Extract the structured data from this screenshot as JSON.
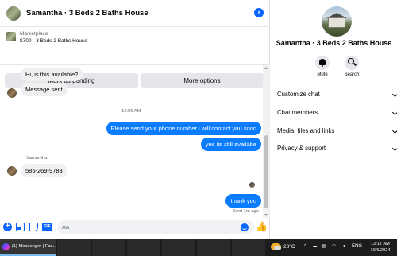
{
  "chat": {
    "title": "Samantha · 3 Beds 2 Baths House",
    "listing": {
      "source": "Marketplace",
      "description": "$700 · 3 Beds 2 Baths House"
    },
    "buttons": {
      "mark_pending": "Mark as pending",
      "more_options": "More options"
    },
    "messages": [
      {
        "direction": "incoming",
        "text": "Hi, is this available?"
      },
      {
        "direction": "incoming",
        "text": "Message sent"
      },
      {
        "type": "timestamp",
        "text": "12:06 AM"
      },
      {
        "direction": "outgoing",
        "text": "Please send your phone number i will contact you soon"
      },
      {
        "direction": "outgoing",
        "text": "yes its still availabe"
      },
      {
        "type": "sender",
        "text": "Samantha"
      },
      {
        "direction": "incoming",
        "text": "585-269-9783"
      },
      {
        "direction": "outgoing",
        "text": "thank you"
      },
      {
        "type": "status",
        "text": "Sent 1m ago"
      }
    ],
    "composer": {
      "placeholder": "Aa"
    }
  },
  "info_panel": {
    "name": "Samantha · 3 Beds 2 Baths House",
    "actions": [
      {
        "label": "Mute",
        "icon": "bell-icon"
      },
      {
        "label": "Search",
        "icon": "search-icon"
      }
    ],
    "menu": [
      {
        "label": "Customize chat"
      },
      {
        "label": "Chat members"
      },
      {
        "label": "Media, files and links"
      },
      {
        "label": "Privacy & support"
      }
    ]
  },
  "taskbar": {
    "active_app": "(1) Messenger | Fac...",
    "weather": "28°C",
    "language": "ENG",
    "time": "12:17 AM",
    "date": "10/6/2024"
  },
  "colors": {
    "accent": "#0866ff",
    "outgoing_bubble": "#0a7cff",
    "incoming_bubble": "#f0f0f0",
    "taskbar": "#1c1c1c"
  }
}
